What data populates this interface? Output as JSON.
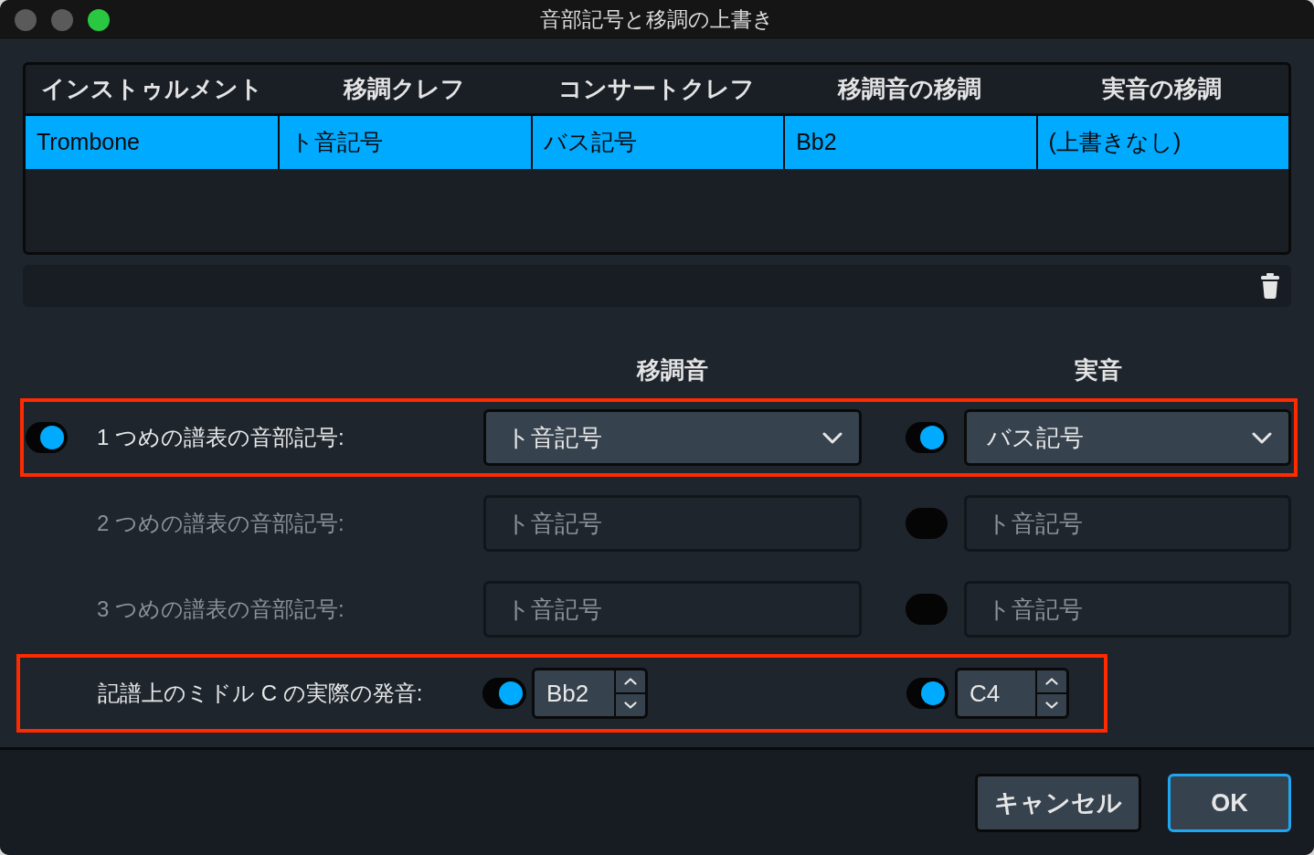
{
  "window": {
    "title": "音部記号と移調の上書き",
    "controls": [
      {
        "kind": "close",
        "enabled": false
      },
      {
        "kind": "minimize",
        "enabled": false
      },
      {
        "kind": "zoom",
        "enabled": true
      }
    ]
  },
  "table": {
    "columns": [
      "インストゥルメント",
      "移調クレフ",
      "コンサートクレフ",
      "移調音の移調",
      "実音の移調"
    ],
    "rows": [
      {
        "cells": [
          "Trombone",
          "ト音記号",
          "バス記号",
          "Bb2",
          "(上書きなし)"
        ],
        "selected": true
      }
    ]
  },
  "override_headers": [
    "移調音",
    "実音"
  ],
  "clef_rows": [
    {
      "label": "1 つめの譜表の音部記号:",
      "disabled": false,
      "highlighted": true,
      "toggle": {
        "on": true
      },
      "transposed_clef": {
        "value": "ト音記号",
        "disabled": false
      },
      "concert_toggle": {
        "on": true
      },
      "concert_clef": {
        "value": "バス記号",
        "disabled": false
      }
    },
    {
      "label": "2 つめの譜表の音部記号:",
      "disabled": true,
      "highlighted": false,
      "transposed_clef": {
        "value": "ト音記号",
        "disabled": true
      },
      "concert_toggle": {
        "on": false
      },
      "concert_clef": {
        "value": "ト音記号",
        "disabled": true
      }
    },
    {
      "label": "3 つめの譜表の音部記号:",
      "disabled": true,
      "highlighted": false,
      "transposed_clef": {
        "value": "ト音記号",
        "disabled": true
      },
      "concert_toggle": {
        "on": false
      },
      "concert_clef": {
        "value": "ト音記号",
        "disabled": true
      }
    }
  ],
  "middle_c": {
    "label": "記譜上のミドル C の実際の発音:",
    "highlighted": true,
    "transposed": {
      "on": true,
      "value": "Bb2"
    },
    "concert": {
      "on": true,
      "value": "C4"
    }
  },
  "buttons": [
    {
      "label": "キャンセル",
      "default": false
    },
    {
      "label": "OK",
      "default": true
    }
  ]
}
